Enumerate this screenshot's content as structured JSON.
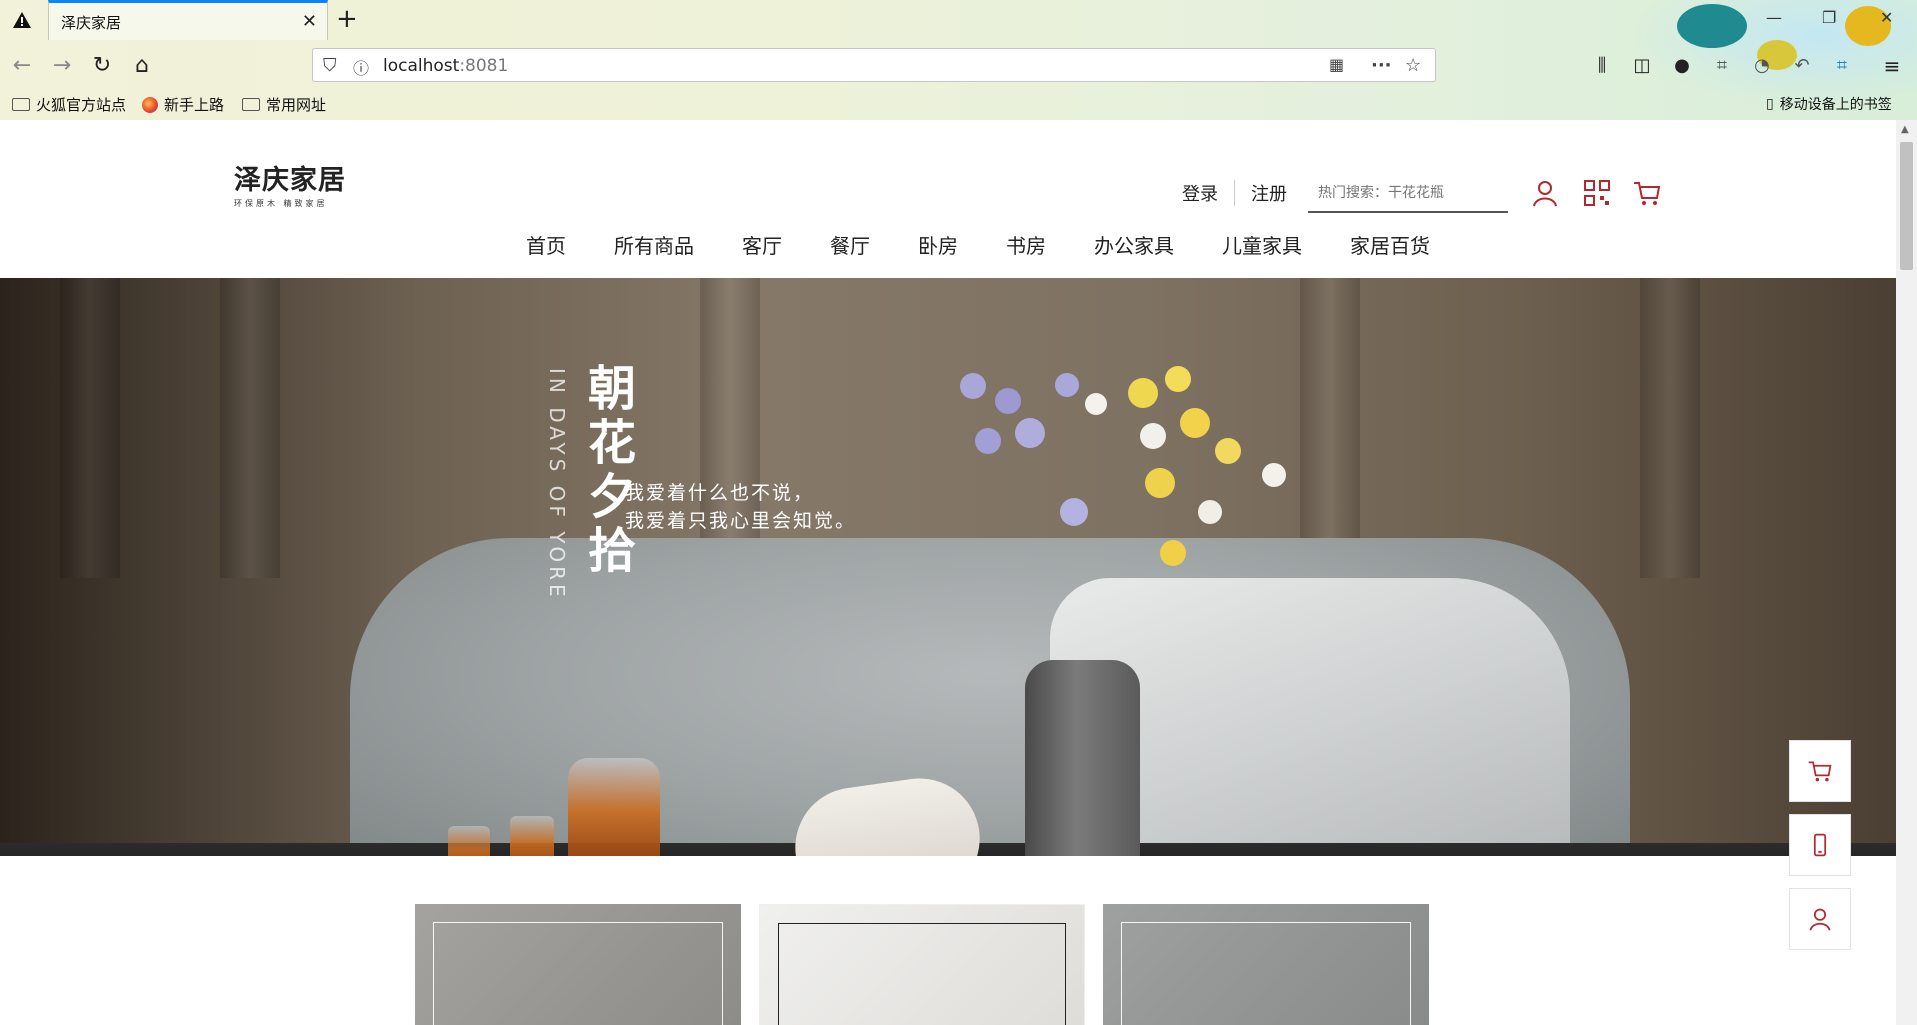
{
  "browser": {
    "tab_title": "泽庆家居",
    "url_host": "localhost",
    "url_port": ":8081",
    "bookmarks": [
      "火狐官方站点",
      "新手上路",
      "常用网址"
    ],
    "mobile_bookmarks": "移动设备上的书签"
  },
  "header": {
    "logo_text": "泽庆家居",
    "logo_subtitle": "环保原木  精致家居",
    "login": "登录",
    "register": "注册",
    "search_placeholder": "热门搜索：干花花瓶"
  },
  "nav": {
    "items": [
      "首页",
      "所有商品",
      "客厅",
      "餐厅",
      "卧房",
      "书房",
      "办公家具",
      "儿童家具",
      "家居百货"
    ]
  },
  "banner": {
    "vertical_en": "IN DAYS OF YORE",
    "title": "朝花夕拾",
    "line1": "我爱着什么也不说，",
    "line2": "我爱着只我心里会知觉。"
  },
  "side_tools": [
    "cart-icon",
    "phone-icon",
    "user-icon"
  ],
  "colors": {
    "accent": "#b3282d",
    "tab_accent": "#0a84ff",
    "logo_box": "#1e4a1a"
  }
}
